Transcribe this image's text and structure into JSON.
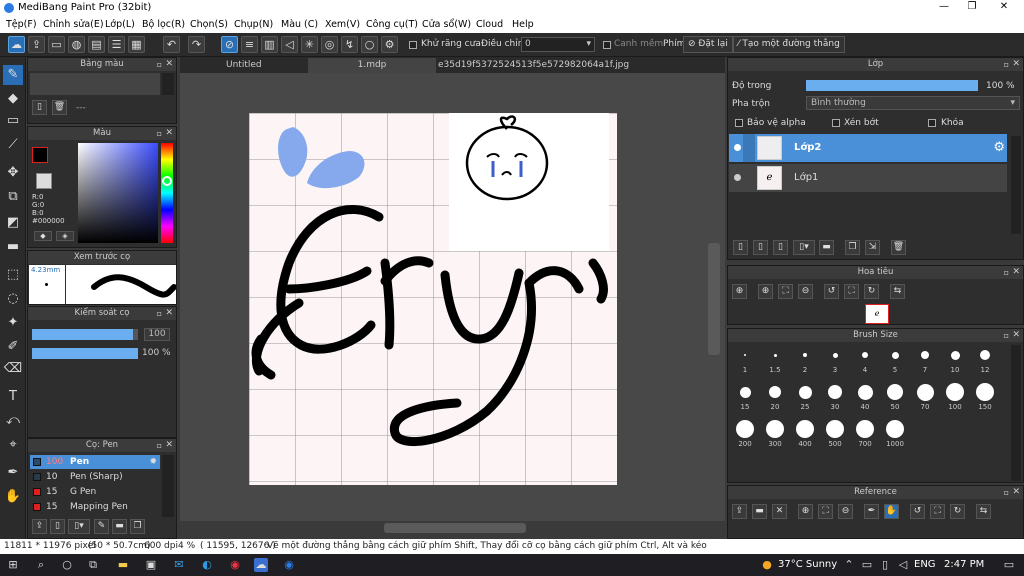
{
  "window": {
    "title": "MediBang Paint Pro (32bit)",
    "min": "—",
    "max": "❐",
    "close": "✕"
  },
  "menu": [
    "Tệp(F)",
    "Chỉnh sửa(E)",
    "Lớp(L)",
    "Bộ lọc(R)",
    "Chọn(S)",
    "Chụp(N)",
    "Màu (C)",
    "Xem(V)",
    "Công cụ(T)",
    "Cửa sổ(W)",
    "Cloud",
    "Help"
  ],
  "toolbar": {
    "antialias_label": "Khử răng cưa",
    "adjust_label": "Điều chỉnh",
    "adjust_value": "0",
    "margin_label": "Canh mềm",
    "key_label": "Phím",
    "reset_label": "Đặt lại",
    "straight_label": "Tạo một đường thẳng"
  },
  "tabs": [
    "Untitled",
    "1.mdp",
    "e35d19f5372524513f5e572982064a1f.jpg"
  ],
  "palette_panel": {
    "title": "Bảng màu",
    "field": "---"
  },
  "color_panel": {
    "title": "Màu",
    "r": "R:0",
    "g": "G:0",
    "b": "B:0",
    "hex": "#000000"
  },
  "preview_panel": {
    "title": "Xem trước cọ",
    "size": "4.23mm"
  },
  "brush_control": {
    "title": "Kiểm soát cọ",
    "size_value": "100",
    "opacity_value": "100 %",
    "size_level": 0.95,
    "opacity_level": 1.0
  },
  "brush_list": {
    "title": "Cọ: Pen",
    "items": [
      {
        "num": "100",
        "name": "Pen"
      },
      {
        "num": "10",
        "name": "Pen (Sharp)"
      },
      {
        "num": "15",
        "name": "G Pen"
      },
      {
        "num": "15",
        "name": "Mapping Pen"
      }
    ]
  },
  "layer_panel": {
    "title": "Lớp",
    "opacity_label": "Độ trong",
    "opacity_value": "100 %",
    "opacity_level": 1.0,
    "blend_label": "Pha trộn",
    "blend_value": "Bình thường",
    "protect_alpha": "Bảo vệ alpha",
    "clip": "Xén bớt",
    "lock": "Khóa",
    "layers": [
      {
        "name": "Lớp2"
      },
      {
        "name": "Lớp1"
      }
    ]
  },
  "navigator_panel": {
    "title": "Hoa tiêu"
  },
  "brush_size_panel": {
    "title": "Brush Size",
    "sizes": [
      "1",
      "1.5",
      "2",
      "3",
      "4",
      "5",
      "7",
      "10",
      "12",
      "15",
      "20",
      "25",
      "30",
      "40",
      "50",
      "70",
      "100",
      "150",
      "200",
      "300",
      "400",
      "500",
      "700",
      "1000"
    ]
  },
  "reference_panel": {
    "title": "Reference"
  },
  "status": {
    "dims": "11811 * 11976 pixel",
    "size_cm": "(50 * 50.7cm)",
    "dpi": "600 dpi",
    "zoom": "4 %",
    "coords": "( 11595, 12676 )",
    "hint": "Vẽ một đường thẳng bằng cách giữ phím Shift, Thay đổi cỡ cọ bằng cách giữ phím Ctrl, Alt và kéo"
  },
  "taskbar": {
    "weather": "37°C Sunny",
    "lang": "ENG",
    "time": "2:47 PM"
  },
  "colors": {
    "accent": "#2a6fb5",
    "layer_selected": "#4a90d9",
    "red": "#e02020"
  }
}
